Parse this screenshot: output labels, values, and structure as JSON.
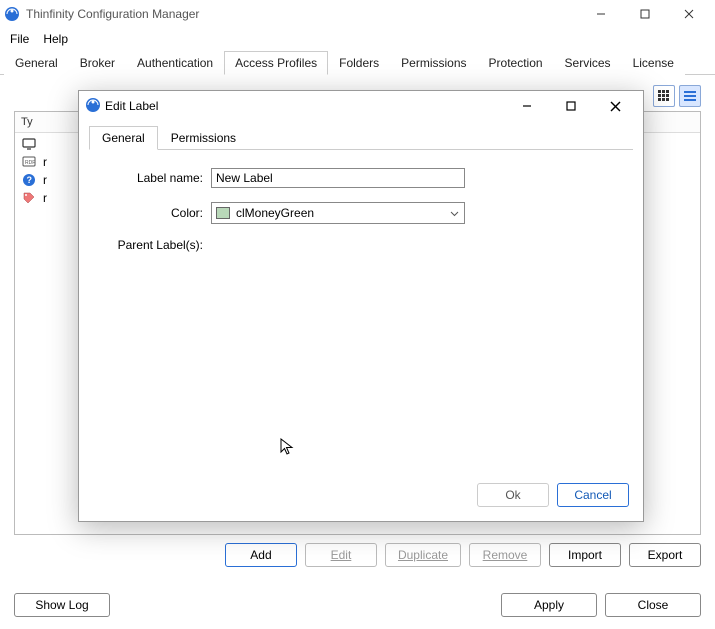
{
  "app": {
    "title": "Thinfinity Configuration Manager"
  },
  "menu": {
    "file": "File",
    "help": "Help"
  },
  "tabs": {
    "general": "General",
    "broker": "Broker",
    "authentication": "Authentication",
    "access_profiles": "Access Profiles",
    "folders": "Folders",
    "permissions": "Permissions",
    "protection": "Protection",
    "services": "Services",
    "license": "License"
  },
  "list": {
    "header_type": "Ty",
    "rows": [
      {
        "icon": "monitor-icon",
        "text": ""
      },
      {
        "icon": "rdp-icon",
        "text": "r"
      },
      {
        "icon": "help-globe-icon",
        "text": "r"
      },
      {
        "icon": "tag-icon",
        "text": "r"
      }
    ]
  },
  "buttons": {
    "add": "Add",
    "edit": "Edit",
    "duplicate": "Duplicate",
    "remove": "Remove",
    "import": "Import",
    "export": "Export",
    "show_log": "Show Log",
    "apply": "Apply",
    "close": "Close"
  },
  "dialog": {
    "title": "Edit Label",
    "tabs": {
      "general": "General",
      "permissions": "Permissions"
    },
    "form": {
      "label_name_label": "Label name:",
      "label_name_value": "New Label",
      "color_label": "Color:",
      "color_value": "clMoneyGreen",
      "color_hex": "#b9d8b9",
      "parent_labels_label": "Parent Label(s):"
    },
    "buttons": {
      "ok": "Ok",
      "cancel": "Cancel"
    }
  }
}
